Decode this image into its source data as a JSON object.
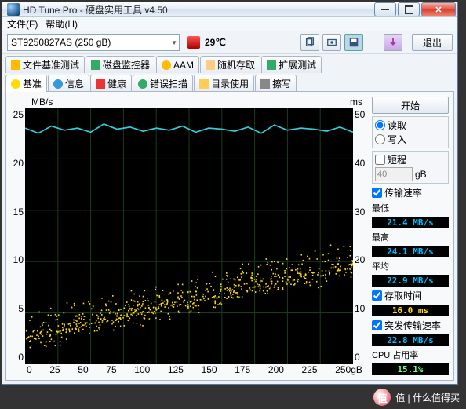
{
  "window": {
    "title": "HD Tune Pro - 硬盘实用工具 v4.50"
  },
  "menu": {
    "file": "文件(F)",
    "help": "帮助(H)"
  },
  "toolbar": {
    "drive": "ST9250827AS        (250 gB)",
    "temp": "29℃",
    "exit": "退出"
  },
  "tabs_top": [
    {
      "icon": "file-benchmark",
      "label": "文件基准测试"
    },
    {
      "icon": "disk-monitor",
      "label": "磁盘监控器"
    },
    {
      "icon": "aam",
      "label": "AAM"
    },
    {
      "icon": "random-access",
      "label": "随机存取"
    },
    {
      "icon": "extra-tests",
      "label": "扩展测试"
    }
  ],
  "tabs_bottom": [
    {
      "icon": "benchmark",
      "label": "基准",
      "active": true
    },
    {
      "icon": "info",
      "label": "信息"
    },
    {
      "icon": "health",
      "label": "健康"
    },
    {
      "icon": "error-scan",
      "label": "错误扫描"
    },
    {
      "icon": "folder-usage",
      "label": "目录使用"
    },
    {
      "icon": "erase",
      "label": "擦写"
    }
  ],
  "side": {
    "start": "开始",
    "read": "读取",
    "write": "写入",
    "short": "短程",
    "short_val": "40",
    "short_unit": "gB",
    "transfer": "传输速率",
    "min_l": "最低",
    "min_v": "21.4 MB/s",
    "max_l": "最高",
    "max_v": "24.1 MB/s",
    "avg_l": "平均",
    "avg_v": "22.9 MB/s",
    "access_l": "存取时间",
    "access_v": "16.0 ms",
    "burst_l": "突发传输速率",
    "burst_v": "22.8 MB/s",
    "cpu_l": "CPU 占用率",
    "cpu_v": "15.1%"
  },
  "chart_data": {
    "type": "line+scatter",
    "title": "",
    "x_unit": "gB",
    "x_ticks": [
      0,
      25,
      50,
      75,
      100,
      125,
      150,
      175,
      200,
      225,
      "250gB"
    ],
    "y_left_label": "MB/s",
    "y_left_ticks": [
      25,
      20,
      15,
      10,
      5,
      0
    ],
    "y_right_label": "ms",
    "y_right_ticks": [
      50,
      40,
      30,
      20,
      10,
      0
    ],
    "transfer_line_approx_MB_s": [
      23,
      22.5,
      23.2,
      22.8,
      23,
      22.6,
      23.4,
      22.9,
      23.1,
      22.7,
      23,
      22.8,
      23.2,
      22.6,
      23,
      22.9,
      22.7,
      23.1,
      22.5,
      23.3,
      22.8,
      23,
      22.9,
      22.7,
      23.1,
      22.6
    ],
    "access_scatter_ms_range": [
      3,
      30
    ],
    "access_scatter_trend": "increasing with position; dense cloud rising from ~5ms at 0gB to ~20ms at 250gB, occasional points up to ~30ms"
  },
  "watermark": "值 | 什么值得买"
}
